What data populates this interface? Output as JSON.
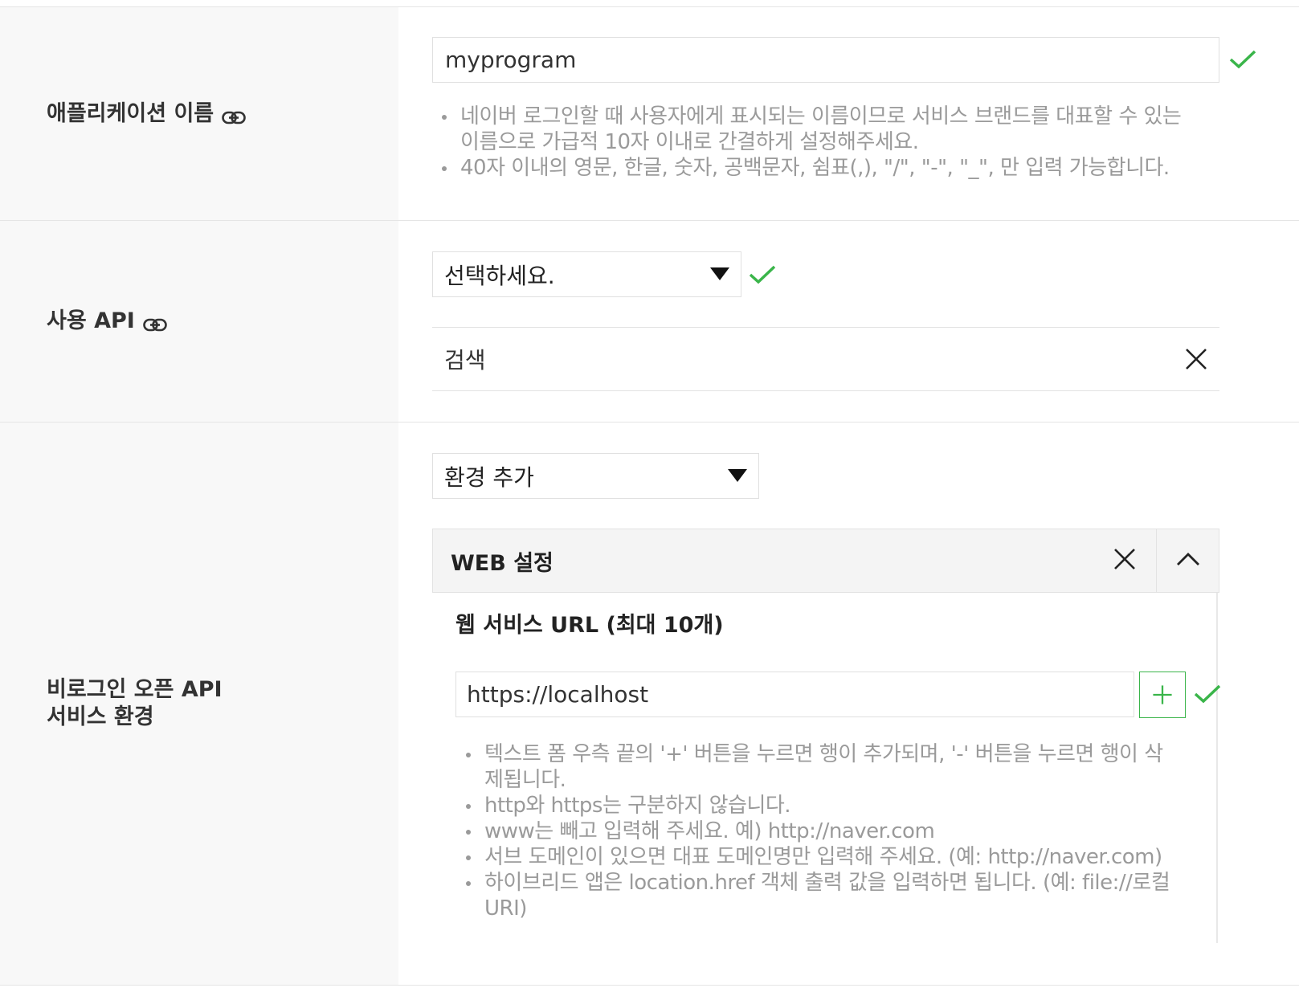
{
  "app_name": {
    "label": "애플리케이션 이름",
    "value": "myprogram",
    "help": [
      "네이버 로그인할 때 사용자에게 표시되는 이름이므로 서비스 브랜드를 대표할 수 있는 이름으로 가급적 10자 이내로 간결하게 설정해주세요.",
      "40자 이내의 영문, 한글, 숫자, 공백문자, 쉼표(,), \"/\", \"-\", \"_\", 만 입력 가능합니다."
    ]
  },
  "api": {
    "label": "사용 API",
    "select_value": "선택하세요.",
    "selected_items": [
      "검색"
    ]
  },
  "environment": {
    "label_line1": "비로그인 오픈 API",
    "label_line2": "서비스 환경",
    "select_value": "환경 추가",
    "panel_title": "WEB 설정",
    "url_section_title": "웹 서비스 URL (최대 10개)",
    "url_value": "https://localhost",
    "help": [
      "텍스트 폼 우측 끝의 '+' 버튼을 누르면 행이 추가되며, '-' 버튼을 누르면 행이 삭제됩니다.",
      "http와 https는 구분하지 않습니다.",
      "www는 빼고 입력해 주세요. 예) http://naver.com",
      "서브 도메인이 있으면 대표 도메인명만 입력해 주세요. (예: http://naver.com)",
      "하이브리드 앱은 location.href 객체 출력 값을 입력하면 됩니다. (예: file://로컬 URI)"
    ]
  },
  "colors": {
    "valid_check": "#3ab54a",
    "help_text": "#9a9a9a",
    "label_bg": "#f8f8f8"
  },
  "icons": {
    "link": "link-icon",
    "check": "check-icon",
    "close": "close-icon",
    "collapse": "chevron-up-icon",
    "add": "plus-icon",
    "dropdown": "caret-down-icon"
  }
}
